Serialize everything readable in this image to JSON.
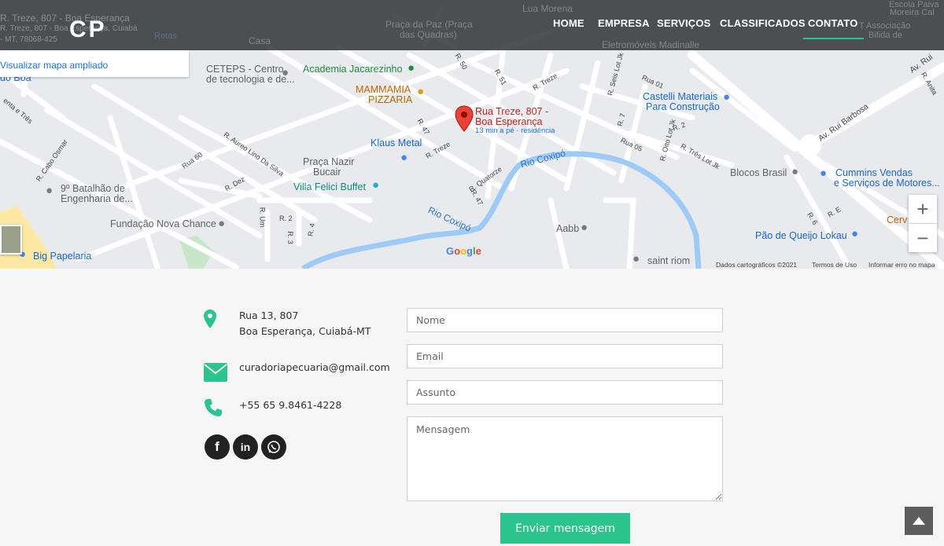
{
  "header": {
    "logo": "CP",
    "ghost_lines": [
      "R. Treze, 807 - Boa Esperança",
      "R. Treze, 807 - Boa Esperança, Cuiabá",
      "- MT, 78068-425"
    ],
    "nav": [
      "HOME",
      "EMPRESA",
      "SERVIÇOS",
      "CLASSIFICADOS",
      "CONTATO"
    ],
    "active": "CONTATO"
  },
  "map": {
    "view_larger": "Visualizar mapa ampliado",
    "pin_title_1": "Rua Treze, 807 -",
    "pin_title_2": "Boa Esperança",
    "pin_sub": "13 min a pé · residência",
    "pois": {
      "ceteps_1": "CETEPS - Centro",
      "ceteps_2": "de tecnologia e de...",
      "academia": "Academia Jacarezinho",
      "mammamia_1": "MAMMAMIA",
      "mammamia_2": "PIZZARIA",
      "klaus": "Klaus Metal",
      "praca_1": "Praça Nazir",
      "praca_2": "Bucair",
      "villa": "Villa Felici Buffet",
      "batalhao_1": "9º Batalhão de",
      "batalhao_2": "Engenharia de...",
      "fundacao": "Fundação Nova Chance",
      "castelli_1": "Castelli Materiais",
      "castelli_2": "Para Construção",
      "blocos": "Blocos Brasil",
      "cummins_1": "Cummins Vendas",
      "cummins_2": "e Serviços de Motores...",
      "aabb": "Aabb",
      "saint": "saint riom",
      "pao": "Pão de Queijo Lokau",
      "big": "Big Papelaria",
      "cerv": "Cerv",
      "do_boa": "do Boa",
      "praca_paz": "Praça da Paz (Praça",
      "praca_paz_2": "das Quadras)",
      "lua": "Lua Morena",
      "casa": "Casa",
      "eletromoveis": "Eletromóveis Madinalle",
      "escola_1": "Escola Paiva",
      "escola_2": "Moreira Cal",
      "assoc_1": "T Associação",
      "assoc_2": "Bifida de",
      "rotas": "Rotas"
    },
    "streets": {
      "cabo_osmar": "R. Cabo Osmar",
      "aureo": "R. Aureo Lino Da Silva",
      "dez": "R. Dez",
      "rua60": "Rua 60",
      "um": "R. Um",
      "dois": "R. 2",
      "tres": "R. 3",
      "quatro": "R. 4",
      "r47": "R. 47",
      "r47b": "R. 47",
      "r50": "R. 50",
      "r51": "R. 51",
      "treze": "R. Treze",
      "treze2": "R. Treze",
      "quatorze": "R. Quatorze",
      "seis": "R. Seis Lot Jk",
      "rua01": "Rua 01",
      "r7": "R. 7",
      "r2": "R. 2",
      "rua05": "Rua 05",
      "oito": "R. Oito Lot Jk",
      "tres_lot": "R. Três Lot Jk",
      "rui": "Av. Rui Barbosa",
      "rui2": "Av. Rui",
      "anita": "R. Anita",
      "menta": "enta e Três",
      "re": "R. E",
      "r6": "R. 6"
    },
    "rivers": [
      "Rio Coxipó",
      "Rio Coxipó"
    ],
    "google": "Google",
    "attribution": [
      "Dados cartográficos ©2021",
      "Termos de Uso",
      "Informar erro no mapa"
    ],
    "zoom_in": "+",
    "zoom_out": "−"
  },
  "contact": {
    "address_1": "Rua 13, 807",
    "address_2": "Boa Esperança, Cuiabá-MT",
    "email": "curadoriapecuaria@gmail.com",
    "phone": "+55 65 9.8461-4228",
    "social": [
      "facebook-icon",
      "linkedin-icon",
      "whatsapp-icon"
    ]
  },
  "form": {
    "name_placeholder": "Nome",
    "email_placeholder": "Email",
    "subject_placeholder": "Assunto",
    "message_placeholder": "Mensagem",
    "submit": "Enviar mensagem"
  },
  "colors": {
    "accent": "#2bc48e",
    "header": "#323537",
    "page_bg": "#f6f6f6",
    "pin": "#ea4335"
  }
}
